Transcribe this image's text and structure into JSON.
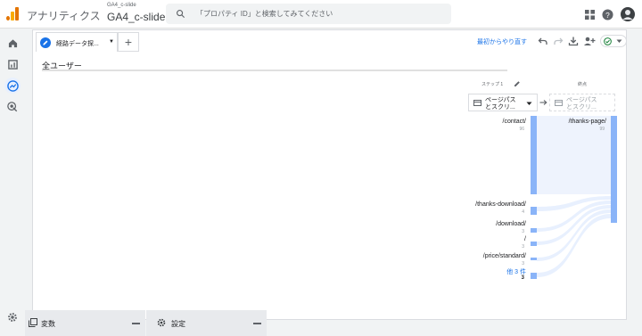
{
  "header": {
    "app_name": "アナリティクス",
    "account_small": "GA4_c-slide",
    "account_big": "GA4_c-slide",
    "search_placeholder": "「プロパティ ID」と検索してみてください",
    "icons": [
      "apps-grid-icon",
      "help-icon",
      "account-avatar"
    ]
  },
  "sidebar": {
    "items": [
      {
        "name": "home-icon"
      },
      {
        "name": "reports-icon"
      },
      {
        "name": "explore-icon",
        "active": true
      },
      {
        "name": "advertising-icon"
      }
    ],
    "settings": "gear-icon"
  },
  "exploration": {
    "tab_label": "経路データ探...",
    "restart_label": "最初からやり直す",
    "segment_title": "全ユーザー",
    "step_label": "ステップ 1",
    "end_label": "終点",
    "step_dropdown": {
      "line1": "ページパス",
      "line2": "とスクリ..."
    },
    "end_dropdown": {
      "line1": "ページパス",
      "line2": "とスクリ..."
    },
    "accent_color": "#1a73e8",
    "node_color": "#8ab4f8",
    "flow_color": "#e8f0fe"
  },
  "flow": {
    "left_nodes": [
      {
        "label": "/contact/",
        "value": "96"
      },
      {
        "label": "/thanks-download/",
        "value": "4"
      },
      {
        "label": "/download/",
        "value": "3"
      },
      {
        "label": "/",
        "value": "3"
      },
      {
        "label": "/price/standard/",
        "value": "3"
      },
      {
        "label": "他 3 件",
        "value": "3"
      }
    ],
    "right_nodes": [
      {
        "label": "/thanks-page/",
        "value": "99"
      }
    ]
  },
  "bottom": {
    "variables_label": "変数",
    "settings_label": "設定"
  }
}
